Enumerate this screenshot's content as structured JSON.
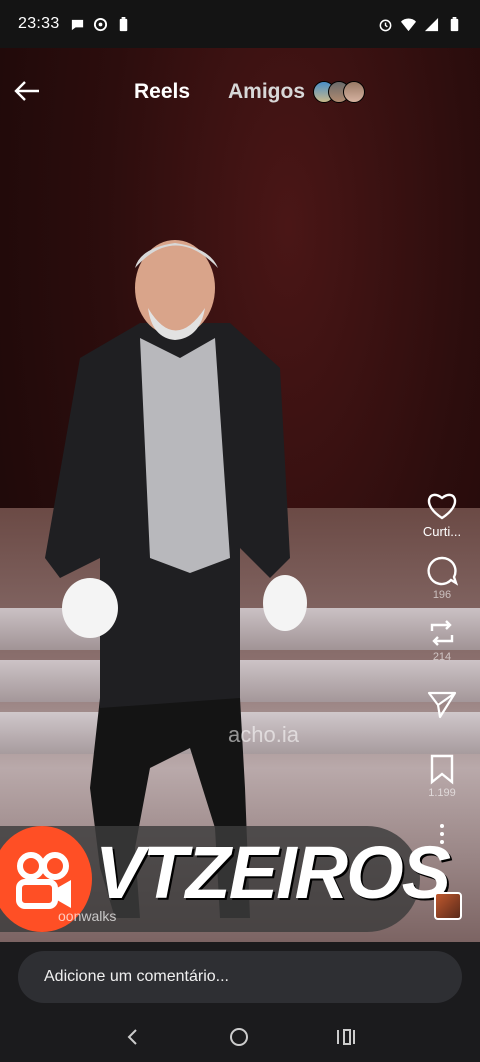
{
  "status": {
    "time": "23:33",
    "left_icons": [
      "chat-bubble-icon",
      "target-icon",
      "battery-saver-icon"
    ],
    "right_icons": [
      "alarm-icon",
      "wifi-icon",
      "signal-icon",
      "battery-icon"
    ]
  },
  "nav": {
    "back_icon": "arrow-left-icon",
    "tab_reels": "Reels",
    "tab_friends": "Amigos"
  },
  "video": {
    "watermark": "acho.ia"
  },
  "actions": {
    "like_label": "Curti...",
    "comments_count": "196",
    "reposts_count": "214",
    "share_count": "",
    "saves_count": "1.199"
  },
  "banner": {
    "title": "VTZEIROS",
    "music": "oonwalks"
  },
  "comment": {
    "placeholder": "Adicione um comentário..."
  },
  "colors": {
    "kwai_orange": "#ff4f25",
    "status_bar_bg": "#141414",
    "bottom_bg": "#1b1b1d",
    "input_bg": "#2e2f33"
  }
}
